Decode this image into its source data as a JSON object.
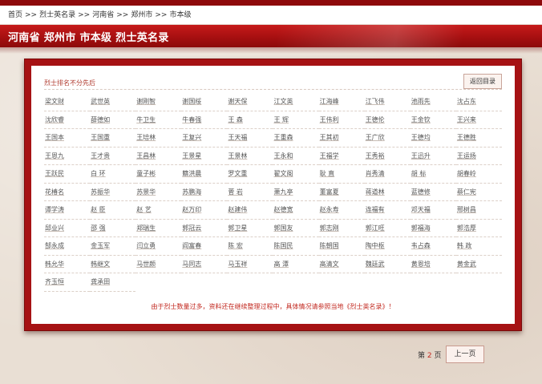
{
  "breadcrumb": [
    "首页",
    "烈士英名录",
    "河南省",
    "郑州市",
    "市本级"
  ],
  "breadcrumb_sep": ">>",
  "banner_title": "河南省 郑州市 市本级 烈士英名录",
  "sort_note": "烈士排名不分先后",
  "back_button": "返回目录",
  "names": [
    "梁文财",
    "武世英",
    "谢刚智",
    "谢国绥",
    "谢天保",
    "江文英",
    "江海峰",
    "江飞伟",
    "池雨先",
    "沈占东",
    "沈欣睿",
    "薛德如",
    "牛卫生",
    "牛春强",
    "王 森",
    "王 辉",
    "王伟利",
    "王德伦",
    "王金钦",
    "王兴来",
    "王国本",
    "王国重",
    "王培林",
    "王复兴",
    "王天福",
    "王重森",
    "王其初",
    "王广欣",
    "王德均",
    "王德胜",
    "王恩九",
    "王才贵",
    "王昌林",
    "王景星",
    "王景林",
    "王永和",
    "王福学",
    "王秀裕",
    "王迅升",
    "王运扬",
    "王跃民",
    "白 环",
    "童子彬",
    "籍洪晨",
    "罗文重",
    "翟文阁",
    "耿 直",
    "肖秀清",
    "胡 标",
    "胡春岭",
    "花椿名",
    "苏振华",
    "苏景华",
    "苏鹏海",
    "菅 岩",
    "萧九亭",
    "董富夏",
    "蒋道林",
    "蓝德修",
    "蔡仁宪",
    "谭学涛",
    "赵 臣",
    "赵 艺",
    "赵万印",
    "赵建伟",
    "赵德宽",
    "赵永寿",
    "连福有",
    "邓天福",
    "邢树昌",
    "邱业兴",
    "邵 强",
    "郑瑞生",
    "郭冠云",
    "郭卫星",
    "郭国友",
    "郭志刚",
    "郭江旺",
    "郭福海",
    "郭浩厚",
    "郜永成",
    "金玉军",
    "闫立勇",
    "阎富春",
    "陈 宏",
    "陈国民",
    "陈朝国",
    "陶中枢",
    "韦占森",
    "韩 政",
    "韩允华",
    "韩继文",
    "马世颜",
    "马同志",
    "马玉祥",
    "高 潭",
    "高清文",
    "魏廷武",
    "黄恩培",
    "黄金武",
    "齐玉恒",
    "龚承田"
  ],
  "note": "由于烈士数量过多，资料还在继续整理过程中，具体情况请参照当地《烈士英名录》！",
  "pager": {
    "prefix": "第",
    "page": "2",
    "suffix": "页",
    "prev_button": "上一页"
  },
  "colors": {
    "brand_red": "#a61214",
    "banner_red": "#c61a1a",
    "note_red": "#c2281f",
    "background": "#e9dfd4"
  }
}
